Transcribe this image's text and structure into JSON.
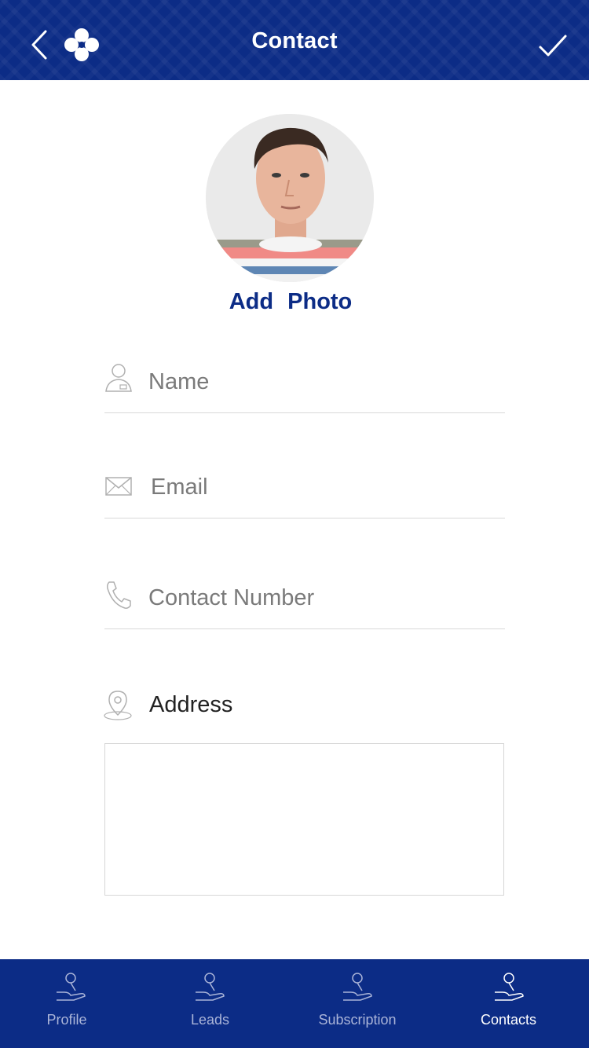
{
  "header": {
    "title": "Contact",
    "back_icon": "chevron-left-icon",
    "logo_icon": "clover-logo-icon",
    "confirm_icon": "checkmark-icon"
  },
  "profile": {
    "photo": "avatar-photo",
    "add_photo_label": "Add Photo"
  },
  "form": {
    "name": {
      "placeholder": "Name",
      "value": "",
      "icon": "person-icon"
    },
    "email": {
      "placeholder": "Email",
      "value": "",
      "icon": "envelope-icon"
    },
    "phone": {
      "placeholder": "Contact Number",
      "value": "",
      "icon": "phone-icon"
    },
    "address": {
      "label": "Address",
      "value": "",
      "icon": "map-pin-icon"
    }
  },
  "tabs": [
    {
      "label": "Profile",
      "icon": "hand-key-icon",
      "active": false
    },
    {
      "label": "Leads",
      "icon": "hand-key-icon",
      "active": false
    },
    {
      "label": "Subscription",
      "icon": "hand-key-icon",
      "active": false
    },
    {
      "label": "Contacts",
      "icon": "hand-key-icon",
      "active": true
    }
  ],
  "colors": {
    "brand": "#0c2c86",
    "tab_inactive": "#aab4d8",
    "tab_active": "#ffffff",
    "divider": "#d9d9d9"
  }
}
